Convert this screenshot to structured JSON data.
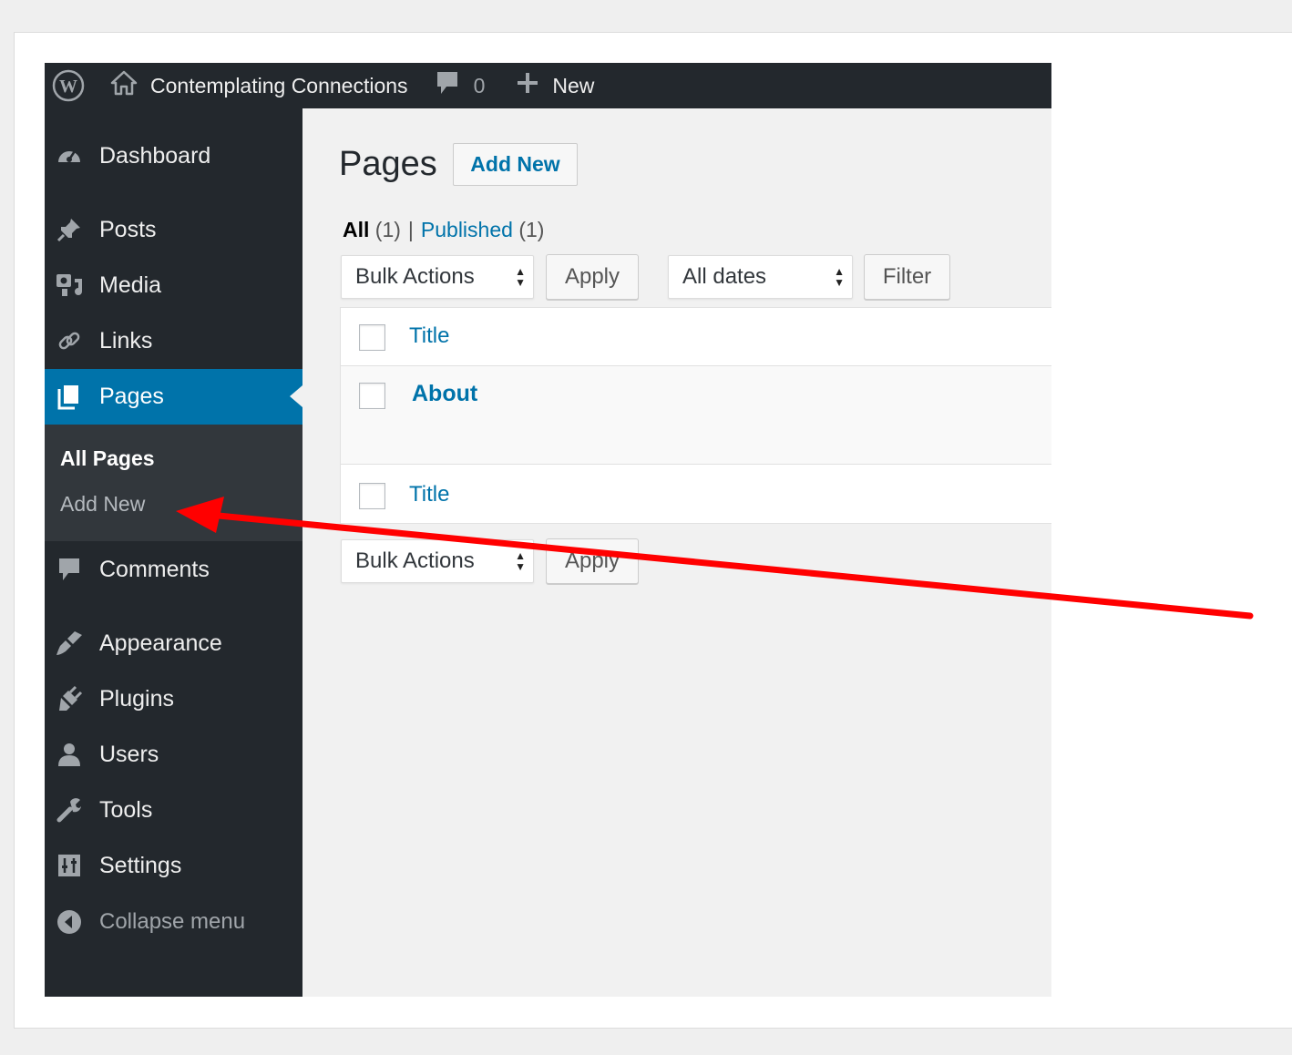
{
  "admin_bar": {
    "site_name": "Contemplating Connections",
    "comments_count": "0",
    "new_label": "New"
  },
  "sidebar": {
    "items": [
      {
        "label": "Dashboard",
        "icon": "dashboard-icon"
      },
      {
        "label": "Posts",
        "icon": "pin-icon"
      },
      {
        "label": "Media",
        "icon": "media-icon"
      },
      {
        "label": "Links",
        "icon": "link-icon"
      },
      {
        "label": "Pages",
        "icon": "pages-icon"
      },
      {
        "label": "Comments",
        "icon": "comment-icon"
      },
      {
        "label": "Appearance",
        "icon": "brush-icon"
      },
      {
        "label": "Plugins",
        "icon": "plug-icon"
      },
      {
        "label": "Users",
        "icon": "user-icon"
      },
      {
        "label": "Tools",
        "icon": "wrench-icon"
      },
      {
        "label": "Settings",
        "icon": "settings-icon"
      }
    ],
    "submenu": {
      "all_pages": "All Pages",
      "add_new": "Add New"
    },
    "collapse_label": "Collapse menu"
  },
  "content": {
    "title": "Pages",
    "add_new_label": "Add New",
    "filters": {
      "all_label": "All",
      "all_count": "(1)",
      "separator": "|",
      "published_label": "Published",
      "published_count": "(1)"
    },
    "bulk_actions": "Bulk Actions",
    "apply_label": "Apply",
    "dates_filter": "All dates",
    "filter_label": "Filter",
    "table": {
      "column_title": "Title",
      "rows": [
        {
          "title": "About"
        }
      ]
    }
  },
  "colors": {
    "admin_bar": "#23282d",
    "accent": "#0073aa",
    "annotation_arrow": "#ff0000"
  }
}
